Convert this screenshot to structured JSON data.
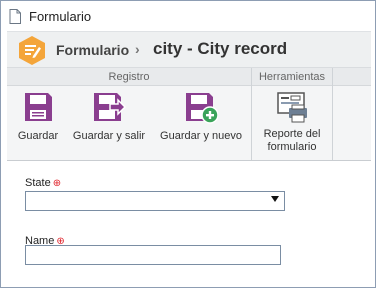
{
  "window": {
    "title": "Formulario"
  },
  "header": {
    "breadcrumb": "Formulario",
    "separator": "›",
    "record_title": "city - City record"
  },
  "ribbon": {
    "groups": [
      {
        "label": "Registro"
      },
      {
        "label": "Herramientas"
      }
    ],
    "buttons": {
      "save": "Guardar",
      "save_exit": "Guardar y salir",
      "save_new": "Guardar y nuevo",
      "report": "Reporte del formulario"
    }
  },
  "form": {
    "state": {
      "label": "State",
      "value": ""
    },
    "name": {
      "label": "Name",
      "value": ""
    }
  },
  "colors": {
    "accent_purple": "#8a3e8f",
    "logo_orange": "#f4a53a",
    "required_red": "#e0222a"
  },
  "icons": [
    "document-icon",
    "app-logo-icon",
    "save-icon",
    "save-exit-icon",
    "save-new-icon",
    "report-icon",
    "required-icon",
    "dropdown-arrow-icon"
  ]
}
